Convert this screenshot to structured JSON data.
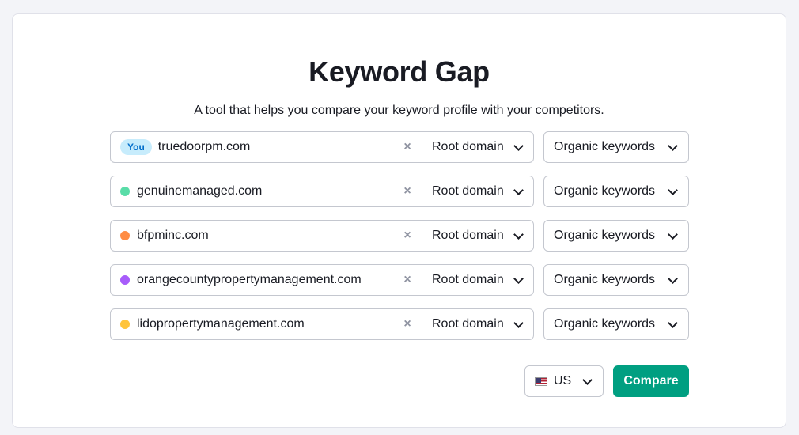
{
  "header": {
    "title": "Keyword Gap",
    "subtitle": "A tool that helps you compare your keyword profile with your competitors."
  },
  "rows": [
    {
      "badge": "You",
      "domain": "truedoorpm.com",
      "dot_color": null,
      "scope": "Root domain",
      "keyword_type": "Organic keywords"
    },
    {
      "badge": null,
      "domain": "genuinemanaged.com",
      "dot_color": "#59dda8",
      "scope": "Root domain",
      "keyword_type": "Organic keywords"
    },
    {
      "badge": null,
      "domain": "bfpminc.com",
      "dot_color": "#ff8c43",
      "scope": "Root domain",
      "keyword_type": "Organic keywords"
    },
    {
      "badge": null,
      "domain": "orangecountypropertymanagement.com",
      "dot_color": "#a75cfa",
      "scope": "Root domain",
      "keyword_type": "Organic keywords"
    },
    {
      "badge": null,
      "domain": "lidopropertymanagement.com",
      "dot_color": "#ffc43b",
      "scope": "Root domain",
      "keyword_type": "Organic keywords"
    }
  ],
  "footer": {
    "country": "US",
    "country_icon": "us-flag-icon",
    "compare_label": "Compare"
  },
  "icons": {
    "clear": "×",
    "dropdown": "chevron-down-icon"
  },
  "colors": {
    "accent": "#009f81",
    "you_badge_bg": "#c7ecfc",
    "you_badge_text": "#006dca"
  }
}
